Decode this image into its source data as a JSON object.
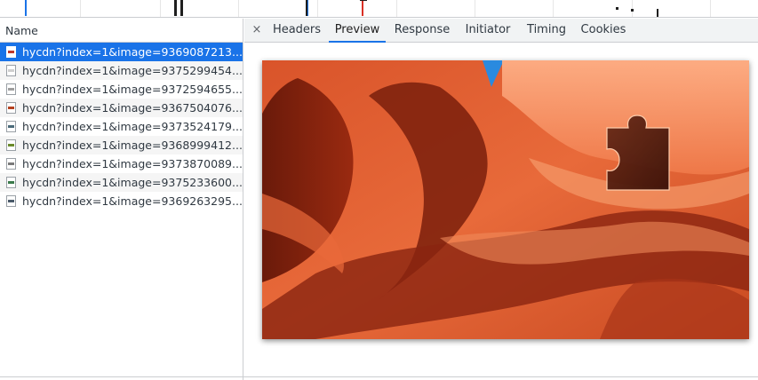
{
  "requests_panel": {
    "header": "Name",
    "items": [
      {
        "label": "hycdn?index=1&image=9369087213...",
        "icon": "image-file-icon",
        "band_color": "#c0392b"
      },
      {
        "label": "hycdn?index=1&image=9375299454...",
        "icon": "image-file-icon",
        "band_color": "#d0d0d0"
      },
      {
        "label": "hycdn?index=1&image=9372594655...",
        "icon": "image-file-icon",
        "band_color": "#9e9e9e"
      },
      {
        "label": "hycdn?index=1&image=9367504076...",
        "icon": "image-file-icon",
        "band_color": "#b5401e"
      },
      {
        "label": "hycdn?index=1&image=9373524179...",
        "icon": "image-file-icon",
        "band_color": "#4a6a7a"
      },
      {
        "label": "hycdn?index=1&image=9368999412...",
        "icon": "image-file-icon",
        "band_color": "#6a8a2a"
      },
      {
        "label": "hycdn?index=1&image=9373870089...",
        "icon": "image-file-icon",
        "band_color": "#7a7a7a"
      },
      {
        "label": "hycdn?index=1&image=9375233600...",
        "icon": "image-file-icon",
        "band_color": "#3a7a4a"
      },
      {
        "label": "hycdn?index=1&image=9369263295...",
        "icon": "image-file-icon",
        "band_color": "#4a5a6a"
      }
    ],
    "selected_index": 0
  },
  "details_panel": {
    "close_label": "×",
    "tabs": [
      "Headers",
      "Preview",
      "Response",
      "Initiator",
      "Timing",
      "Cookies"
    ],
    "active_tab": "Preview"
  },
  "colors": {
    "accent": "#1a73e8",
    "canyon_light": "#f07a4a",
    "canyon_dark": "#5a1408",
    "sky": "#2a8adf"
  }
}
